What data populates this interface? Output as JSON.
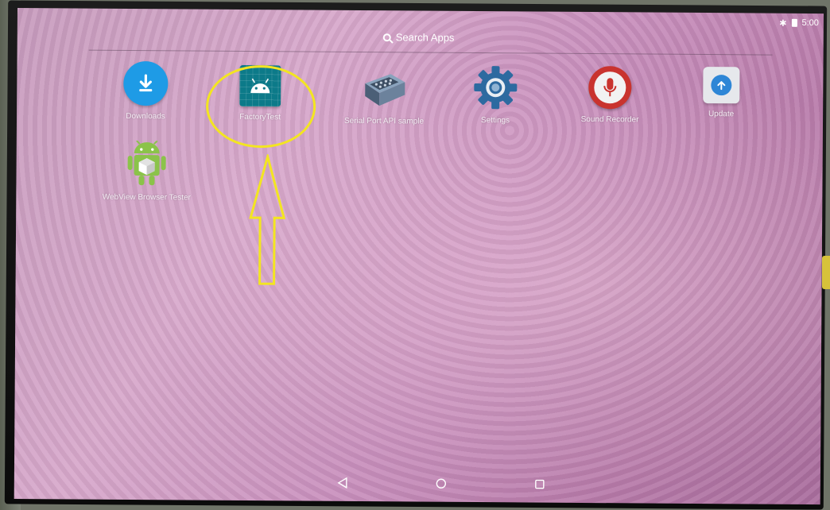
{
  "status_bar": {
    "bluetooth_icon": "bluetooth-icon",
    "battery_icon": "battery-icon",
    "time": "5:00"
  },
  "search": {
    "icon": "search-icon",
    "label": "Search Apps"
  },
  "apps": [
    {
      "label": "Downloads",
      "icon": "download-icon"
    },
    {
      "label": "FactoryTest",
      "icon": "android-icon"
    },
    {
      "label": "Serial Port API sample",
      "icon": "serial-port-icon"
    },
    {
      "label": "Settings",
      "icon": "gear-icon"
    },
    {
      "label": "Sound Recorder",
      "icon": "microphone-icon"
    },
    {
      "label": "Update",
      "icon": "update-arrow-icon"
    },
    {
      "label": "WebView Browser Tester",
      "icon": "android-box-icon"
    }
  ],
  "navigation": {
    "back_icon": "back-triangle-icon",
    "home_icon": "home-circle-icon",
    "recents_icon": "recents-square-icon"
  },
  "annotation": {
    "color": "#f3e521",
    "target": "FactoryTest"
  },
  "colors": {
    "wallpaper": "#c995be",
    "downloads": "#1e9be6",
    "factorytest": "#0c7a89",
    "settings": "#2d6aa0",
    "sound_recorder": "#c9332e",
    "update": "#2e86d6",
    "android_green": "#8bc34a"
  }
}
